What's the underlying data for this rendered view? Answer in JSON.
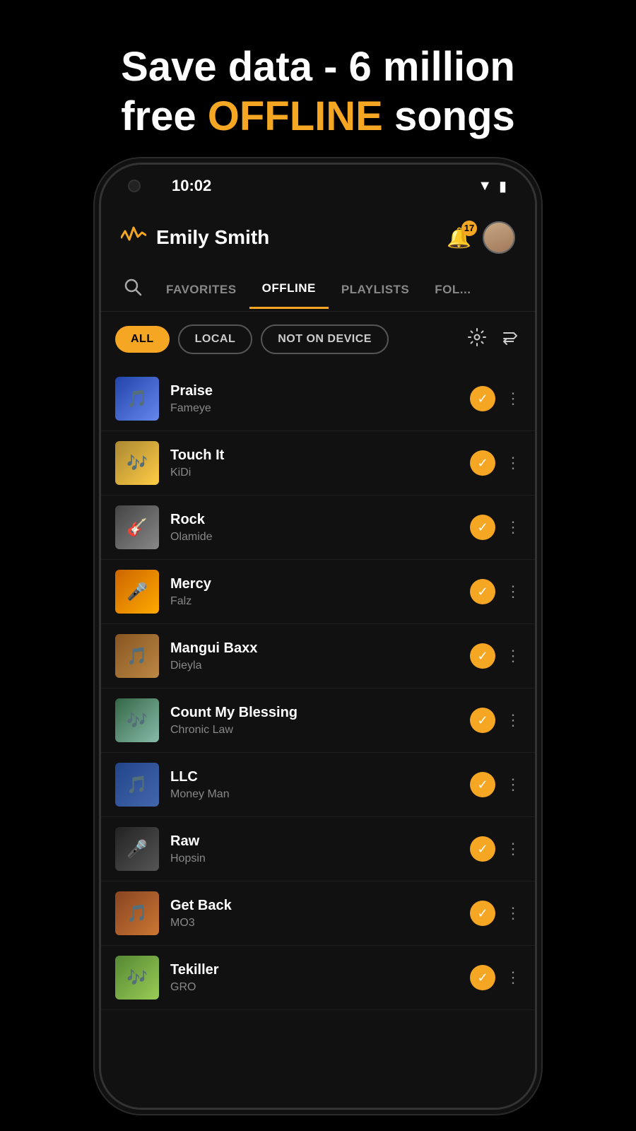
{
  "promo": {
    "line1": "Save data - 6 million",
    "line2_plain": "free ",
    "line2_highlight": "OFFLINE",
    "line2_end": " songs"
  },
  "status_bar": {
    "time": "10:02",
    "wifi": "▼",
    "battery": "🔋"
  },
  "header": {
    "username": "Emily Smith",
    "notification_count": "17"
  },
  "tabs": [
    {
      "label": "FAVORITES",
      "active": false
    },
    {
      "label": "OFFLINE",
      "active": true
    },
    {
      "label": "PLAYLISTS",
      "active": false
    },
    {
      "label": "FOL...",
      "active": false
    }
  ],
  "filters": [
    {
      "label": "ALL",
      "active": true
    },
    {
      "label": "LOCAL",
      "active": false
    },
    {
      "label": "NOT ON DEVICE",
      "active": false
    }
  ],
  "songs": [
    {
      "title": "Praise",
      "artist": "Fameye",
      "thumb_class": "thumb-praise",
      "emoji": "🎵"
    },
    {
      "title": "Touch It",
      "artist": "KiDi",
      "thumb_class": "thumb-touchit",
      "emoji": "🎶"
    },
    {
      "title": "Rock",
      "artist": "Olamide",
      "thumb_class": "thumb-rock",
      "emoji": "🎸"
    },
    {
      "title": "Mercy",
      "artist": "Falz",
      "thumb_class": "thumb-mercy",
      "emoji": "🎤"
    },
    {
      "title": "Mangui Baxx",
      "artist": "Dieyla",
      "thumb_class": "thumb-mangui",
      "emoji": "🎵"
    },
    {
      "title": "Count My Blessing",
      "artist": "Chronic Law",
      "thumb_class": "thumb-count",
      "emoji": "🎶"
    },
    {
      "title": "LLC",
      "artist": "Money Man",
      "thumb_class": "thumb-llc",
      "emoji": "🎵"
    },
    {
      "title": "Raw",
      "artist": "Hopsin",
      "thumb_class": "thumb-raw",
      "emoji": "🎤"
    },
    {
      "title": "Get Back",
      "artist": "MO3",
      "thumb_class": "thumb-getback",
      "emoji": "🎵"
    },
    {
      "title": "Tekiller",
      "artist": "GRO",
      "thumb_class": "thumb-tekiller",
      "emoji": "🎶"
    }
  ]
}
